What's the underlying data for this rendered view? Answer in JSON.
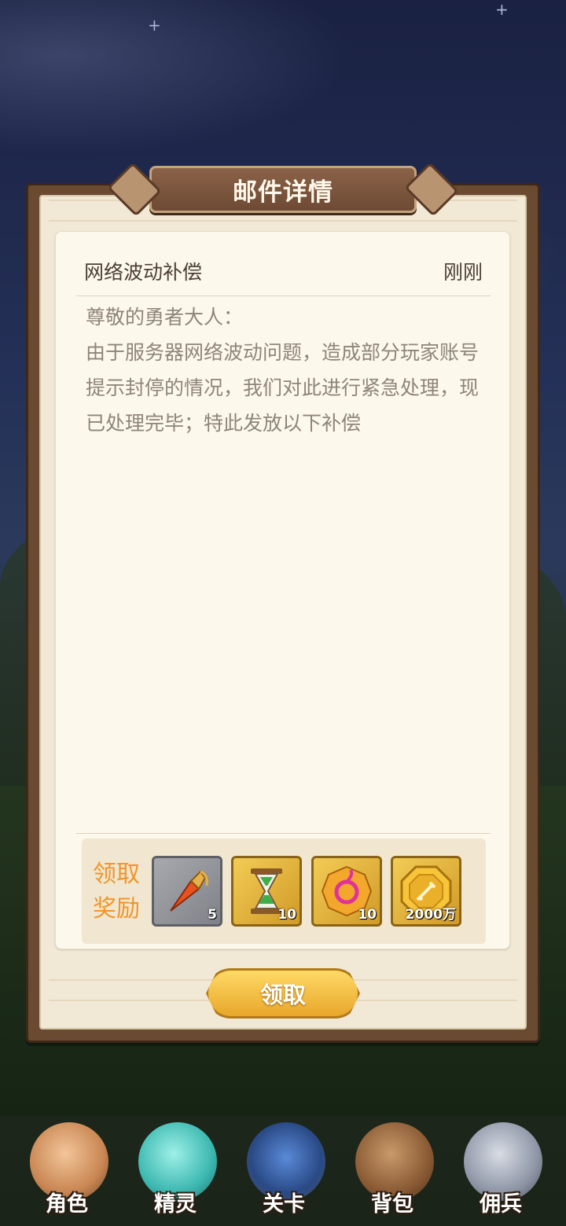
{
  "dialog": {
    "title": "邮件详情"
  },
  "mail": {
    "subject": "网络波动补偿",
    "time": "刚刚",
    "body": "尊敬的勇者大人：\n由于服务器网络波动问题，造成部分玩家账号提示封停的情况，我们对此进行紧急处理，现已处理完毕；特此发放以下补偿"
  },
  "rewards": {
    "label": "领取奖励",
    "items": [
      {
        "icon": "carrot-potion-icon",
        "count": "5"
      },
      {
        "icon": "hourglass-icon",
        "count": "10"
      },
      {
        "icon": "spirit-orb-icon",
        "count": "10"
      },
      {
        "icon": "gold-coin-icon",
        "count": "2000万"
      }
    ]
  },
  "claim_button": "领取",
  "nav": {
    "items": [
      {
        "label": "角色",
        "icon": "hero-portrait-icon"
      },
      {
        "label": "精灵",
        "icon": "slime-icon"
      },
      {
        "label": "关卡",
        "icon": "stage-gate-icon"
      },
      {
        "label": "背包",
        "icon": "backpack-icon"
      },
      {
        "label": "佣兵",
        "icon": "knight-helmet-icon"
      }
    ]
  }
}
